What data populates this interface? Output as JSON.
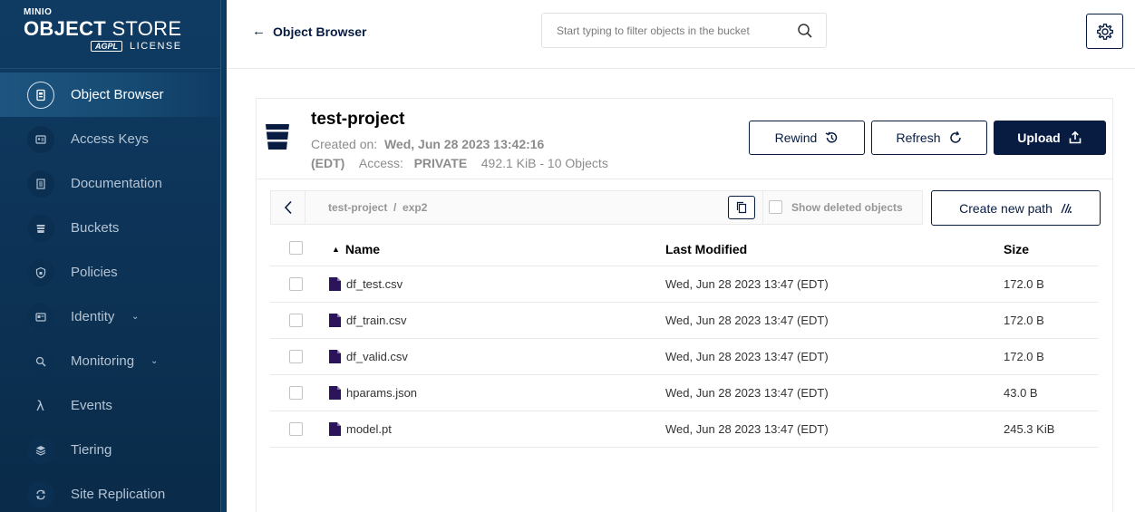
{
  "brand": {
    "minio": "MINIO",
    "product_bold": "OBJECT",
    "product_rest": " STORE",
    "license_badge": "AGPL",
    "license": "LICENSE"
  },
  "sidebar": {
    "items": [
      {
        "label": "Object Browser",
        "icon": "object-browser-icon",
        "active": true
      },
      {
        "label": "Access Keys",
        "icon": "access-keys-icon"
      },
      {
        "label": "Documentation",
        "icon": "documentation-icon"
      },
      {
        "label": "Buckets",
        "icon": "bucket-icon"
      },
      {
        "label": "Policies",
        "icon": "shield-icon"
      },
      {
        "label": "Identity",
        "icon": "identity-icon",
        "expandable": true
      },
      {
        "label": "Monitoring",
        "icon": "monitoring-icon",
        "expandable": true
      },
      {
        "label": "Events",
        "icon": "lambda-icon"
      },
      {
        "label": "Tiering",
        "icon": "layers-icon"
      },
      {
        "label": "Site Replication",
        "icon": "replication-icon"
      }
    ]
  },
  "header": {
    "title": "Object Browser",
    "search_placeholder": "Start typing to filter objects in the bucket"
  },
  "bucket": {
    "name": "test-project",
    "created_label": "Created on:",
    "created_value": "Wed, Jun 28 2023 13:42:16",
    "timezone": "(EDT)",
    "access_label": "Access:",
    "access_value": "PRIVATE",
    "usage": "492.1 KiB - 10 Objects"
  },
  "actions": {
    "rewind": "Rewind",
    "refresh": "Refresh",
    "upload": "Upload"
  },
  "breadcrumb": {
    "root": "test-project",
    "sep": "/",
    "current": "exp2",
    "show_deleted": "Show deleted objects",
    "create_path": "Create new path"
  },
  "table": {
    "headers": {
      "name": "Name",
      "modified": "Last Modified",
      "size": "Size"
    },
    "rows": [
      {
        "name": "df_test.csv",
        "modified": "Wed, Jun 28 2023 13:47 (EDT)",
        "size": "172.0 B"
      },
      {
        "name": "df_train.csv",
        "modified": "Wed, Jun 28 2023 13:47 (EDT)",
        "size": "172.0 B"
      },
      {
        "name": "df_valid.csv",
        "modified": "Wed, Jun 28 2023 13:47 (EDT)",
        "size": "172.0 B"
      },
      {
        "name": "hparams.json",
        "modified": "Wed, Jun 28 2023 13:47 (EDT)",
        "size": "43.0 B"
      },
      {
        "name": "model.pt",
        "modified": "Wed, Jun 28 2023 13:47 (EDT)",
        "size": "245.3 KiB"
      }
    ]
  },
  "colors": {
    "sidebar_bg": "#0f3b63",
    "primary": "#081c42",
    "file_icon": "#2b1459"
  }
}
